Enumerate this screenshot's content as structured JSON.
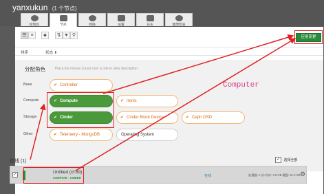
{
  "cluster": {
    "name": "yanxukun",
    "node_count_label": "(1 个节点)"
  },
  "tabs": [
    "控制台",
    "节点",
    "网络",
    "设置",
    "日志",
    "健康检查"
  ],
  "toolbar": {
    "deploy_label": "应用变更"
  },
  "sort": {
    "display_label": "排序",
    "status_label": "状态 ⬇"
  },
  "roles_panel": {
    "title": "分配角色",
    "hint": "Place the mouse cursor over a role to view description.",
    "groups": {
      "base": "Base",
      "compute": "Compute",
      "storage": "Storage",
      "other": "Other"
    },
    "roles": {
      "controller": "Controller",
      "compute": "Compute",
      "ironic": "Ironic",
      "cinder": "Cinder",
      "cinder_block_device": "Cinder Block Device",
      "ceph_osd": "Ceph OSD",
      "telemetry": "Telemetry - MongoDB",
      "operating_system": "Operating System"
    }
  },
  "annotation": {
    "text": "Computer",
    "color": "#d6458d",
    "box_color": "#e02020"
  },
  "online": {
    "title": "在线 (1)",
    "select_all": "选择全部",
    "node": {
      "name": "Untitled (cf:69)",
      "roles": "COMPUTE · CINDER",
      "status": "在线",
      "specs": "处理器: 1 (1)  内存: 3.8 GB  硬盘: 81.0 GB"
    }
  },
  "colors": {
    "selected_role": "#4a9a3c",
    "deploy_button": "#2a8a3c",
    "role_text": "#d66a10"
  }
}
